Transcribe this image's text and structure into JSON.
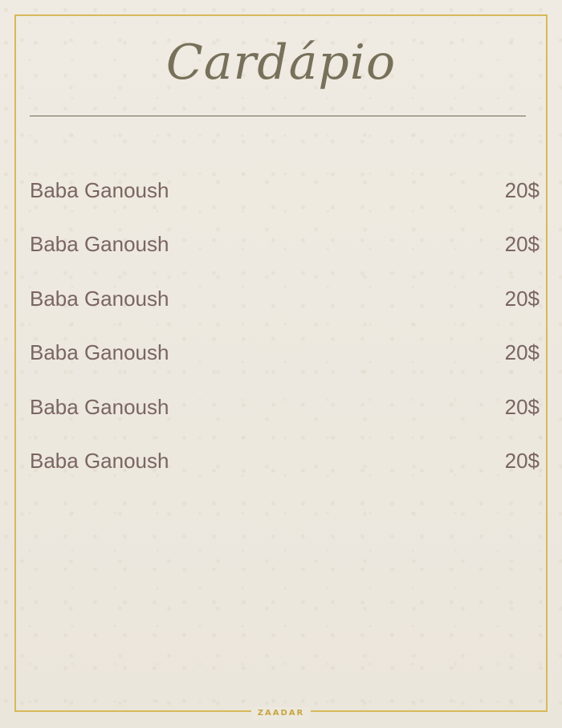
{
  "menu": {
    "title": "Cardápio",
    "items": [
      {
        "name": "Baba Ganoush",
        "price": "20$"
      },
      {
        "name": "Baba Ganoush",
        "price": "20$"
      },
      {
        "name": "Baba Ganoush",
        "price": "20$"
      },
      {
        "name": "Baba Ganoush",
        "price": "20$"
      },
      {
        "name": "Baba Ganoush",
        "price": "20$"
      },
      {
        "name": "Baba Ganoush",
        "price": "20$"
      }
    ]
  },
  "footer": {
    "brand": "ZAADAR"
  },
  "colors": {
    "background": "#ede8de",
    "frame_gold": "#d6b95a",
    "title": "#77705a",
    "item_text": "#7a6562",
    "brand_gold": "#c8a640"
  }
}
